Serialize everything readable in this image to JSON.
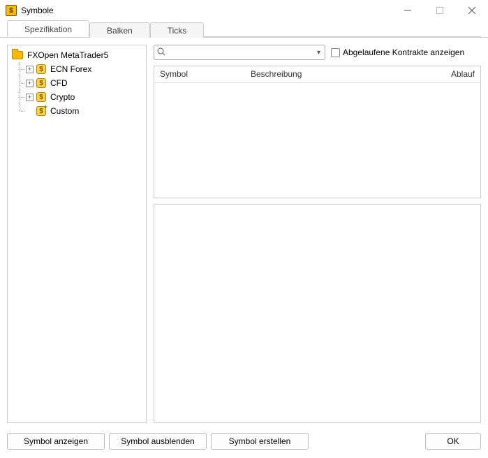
{
  "window": {
    "title": "Symbole"
  },
  "tabs": [
    {
      "label": "Spezifikation",
      "active": true
    },
    {
      "label": "Balken",
      "active": false
    },
    {
      "label": "Ticks",
      "active": false
    }
  ],
  "tree": {
    "root": {
      "label": "FXOpen MetaTrader5"
    },
    "items": [
      {
        "label": "ECN Forex",
        "expandable": true
      },
      {
        "label": "CFD",
        "expandable": true
      },
      {
        "label": "Crypto",
        "expandable": true
      },
      {
        "label": "Custom",
        "expandable": false,
        "addable": true
      }
    ]
  },
  "search": {
    "value": ""
  },
  "checkbox": {
    "label": "Abgelaufene Kontrakte anzeigen",
    "checked": false
  },
  "grid": {
    "columns": {
      "symbol": "Symbol",
      "description": "Beschreibung",
      "expiry": "Ablauf"
    }
  },
  "buttons": {
    "show": "Symbol anzeigen",
    "hide": "Symbol ausblenden",
    "create": "Symbol erstellen",
    "ok": "OK"
  }
}
